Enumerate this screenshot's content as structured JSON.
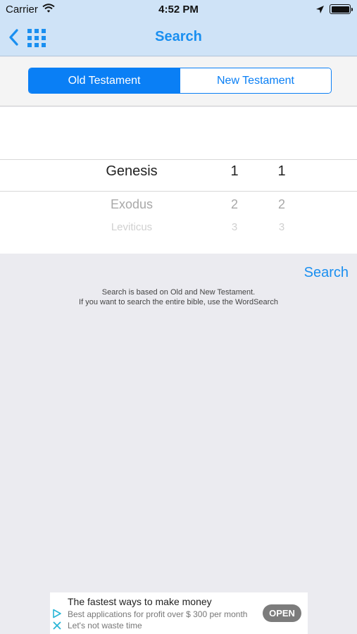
{
  "status_bar": {
    "carrier": "Carrier",
    "time": "4:52 PM"
  },
  "nav": {
    "title": "Search",
    "back_icon": "chevron-left-icon",
    "grid_icon": "grid-icon"
  },
  "segments": {
    "items": [
      {
        "label": "Old Testament",
        "selected": true
      },
      {
        "label": "New Testament",
        "selected": false
      }
    ]
  },
  "picker": {
    "rows": [
      {
        "book": "Genesis",
        "chapter": "1",
        "verse": "1"
      },
      {
        "book": "Exodus",
        "chapter": "2",
        "verse": "2"
      },
      {
        "book": "Leviticus",
        "chapter": "3",
        "verse": "3"
      }
    ]
  },
  "search_button": "Search",
  "note": {
    "line1": "Search is based on Old and New Testament.",
    "line2": "If you want to search the entire bible, use the WordSearch"
  },
  "ad": {
    "title": "The fastest ways to make money",
    "line1": "Best applications for profit over $ 300 per month",
    "line2": "Let's not waste time",
    "button": "OPEN"
  },
  "colors": {
    "accent": "#0a7ff5",
    "title_blue": "#1a8ff0",
    "nav_background": "#cfe3f7",
    "page_background": "#ebebf0"
  }
}
